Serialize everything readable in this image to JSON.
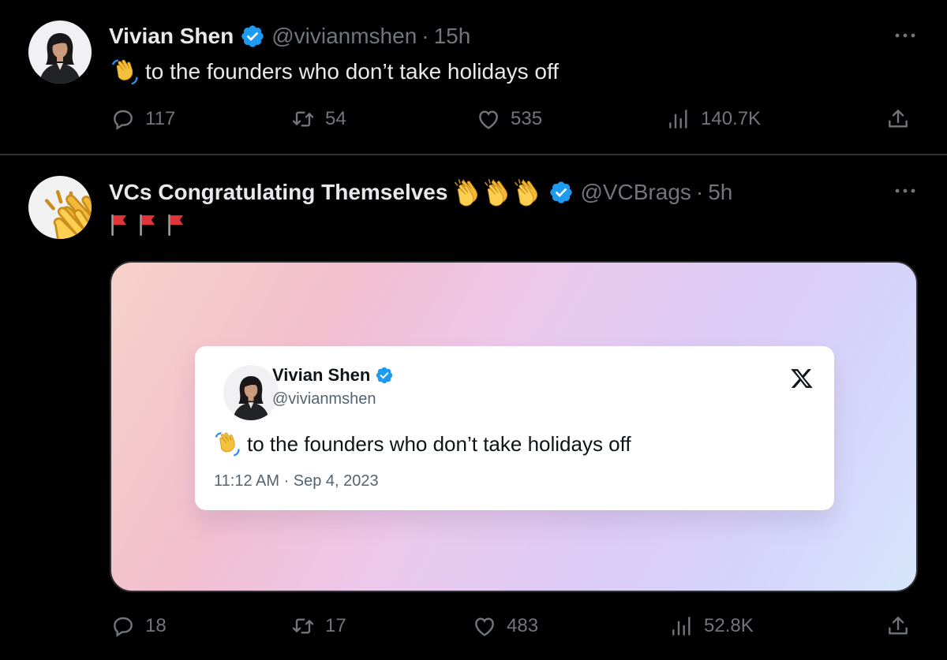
{
  "tweet1": {
    "author_name": "Vivian Shen",
    "handle": "@vivianmshen",
    "separator": "·",
    "time": "15h",
    "text": "to the founders who don’t take holidays off",
    "emoji_icon": "waving-hand-icon",
    "stats": {
      "replies": "117",
      "retweets": "54",
      "likes": "535",
      "views": "140.7K"
    }
  },
  "tweet2": {
    "author_name": "VCs Congratulating Themselves",
    "handle": "@VCBrags",
    "separator": "·",
    "time": "5h",
    "name_emoji_icon": "clapping-hands-icon",
    "body_icons": [
      "red-flag-icon",
      "red-flag-icon",
      "red-flag-icon"
    ],
    "stats": {
      "replies": "18",
      "retweets": "17",
      "likes": "483",
      "views": "52.8K"
    },
    "embedded_card": {
      "author_name": "Vivian Shen",
      "handle": "@vivianmshen",
      "text": "to the founders who don’t take holidays off",
      "timestamp": "11:12 AM · Sep 4, 2023",
      "brand_icon": "x-logo-icon"
    }
  },
  "colors": {
    "background": "#000000",
    "primary_text": "#e7e9ea",
    "secondary_text": "#71767b",
    "divider": "#2f3336",
    "verified_blue": "#1d9bf0"
  }
}
